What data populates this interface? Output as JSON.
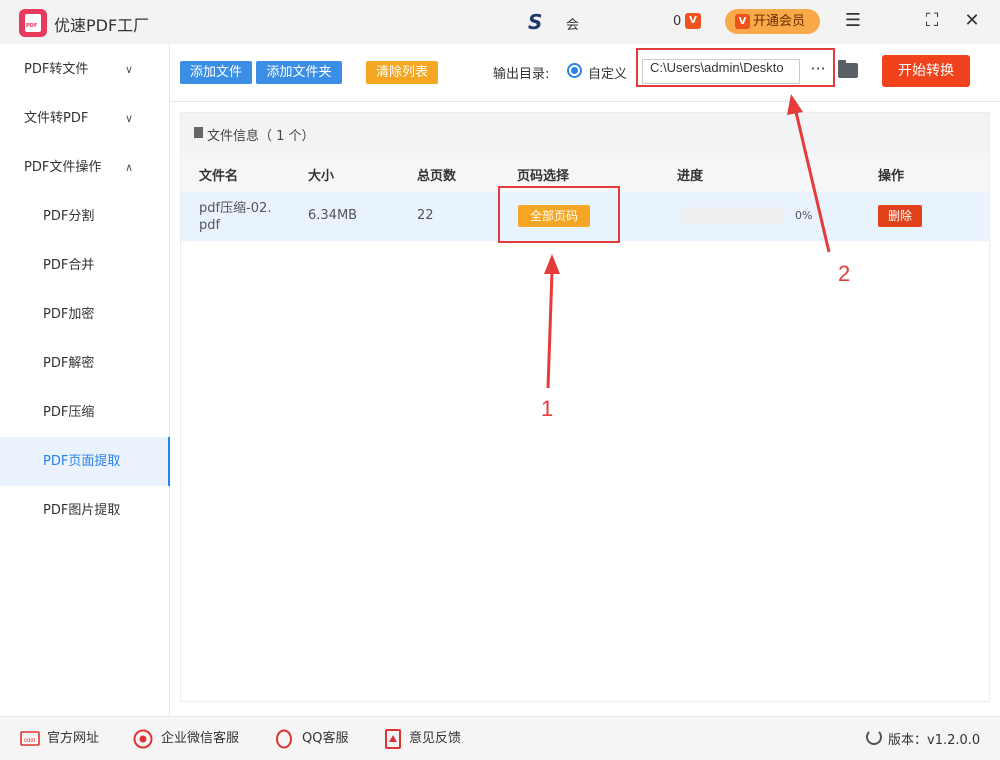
{
  "app": {
    "title": "优速PDF工厂",
    "user_text": "会",
    "coin_count": "0",
    "coin_glyph": "V",
    "vip_label": "开通会员"
  },
  "window_controls": {
    "menu": "☰",
    "maximize": "⛶",
    "close": "✕"
  },
  "sidebar": {
    "items": [
      {
        "label": "PDF转文件",
        "chevron": "∨"
      },
      {
        "label": "文件转PDF",
        "chevron": "∨"
      },
      {
        "label": "PDF文件操作",
        "chevron": "∧"
      },
      {
        "label": "PDF分割"
      },
      {
        "label": "PDF合并"
      },
      {
        "label": "PDF加密"
      },
      {
        "label": "PDF解密"
      },
      {
        "label": "PDF压缩"
      },
      {
        "label": "PDF页面提取"
      },
      {
        "label": "PDF图片提取"
      }
    ]
  },
  "toolbar": {
    "add_file": "添加文件",
    "add_folder": "添加文件夹",
    "clear_list": "清除列表",
    "output_label": "输出目录:",
    "custom_label": "自定义",
    "output_path": "C:\\Users\\admin\\Deskto",
    "more": "···",
    "start": "开始转换"
  },
  "file_info": {
    "text": "文件信息（ 1 个）"
  },
  "table": {
    "headers": [
      "文件名",
      "大小",
      "总页数",
      "页码选择",
      "进度",
      "操作"
    ],
    "rows": [
      {
        "name_line1": "pdf压缩-02.",
        "name_line2": "pdf",
        "size": "6.34MB",
        "pages": "22",
        "page_select": "全部页码",
        "progress_text": "0%",
        "progress_value": 0,
        "action": "删除"
      }
    ]
  },
  "annotations": {
    "n1": "1",
    "n2": "2",
    "color": "#e53b3b"
  },
  "footer": {
    "website": "官方网址",
    "wechat": "企业微信客服",
    "qq": "QQ客服",
    "feedback": "意见反馈",
    "version": "版本：v1.2.0.0"
  }
}
